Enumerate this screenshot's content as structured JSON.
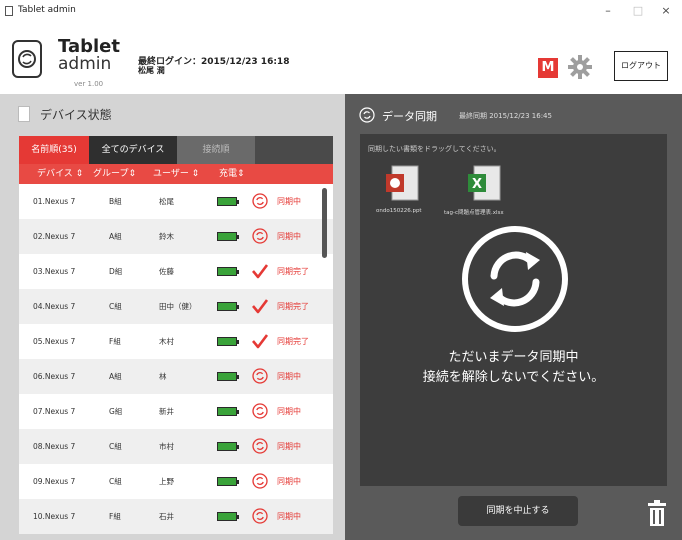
{
  "window": {
    "title": "Tablet admin",
    "minimize": "–",
    "maximize": "□",
    "close": "×"
  },
  "header": {
    "logo_line1": "Tablet",
    "logo_line2": "admin",
    "version": "ver 1.00",
    "last_login": "最終ログイン：2015/12/23 16:18",
    "user": "松尾 潤",
    "badge": "M",
    "logout": "ログアウト",
    "icons": {
      "logo": "tablet-sync-icon",
      "settings": "gear-icon"
    }
  },
  "device_panel": {
    "title": "デバイス状態",
    "tabs": [
      {
        "label": "名前順(35)"
      },
      {
        "label": "全てのデバイス"
      },
      {
        "label": "接続順"
      }
    ],
    "columns": [
      "デバイス ⇕",
      "グループ⇕",
      "ユーザー ⇕",
      "充電⇕"
    ],
    "rows": [
      {
        "device": "01.Nexus 7",
        "group": "B組",
        "user": "松尾",
        "status": "同期中",
        "state": "sync"
      },
      {
        "device": "02.Nexus 7",
        "group": "A組",
        "user": "鈴木",
        "status": "同期中",
        "state": "sync"
      },
      {
        "device": "03.Nexus 7",
        "group": "D組",
        "user": "佐藤",
        "status": "同期完了",
        "state": "done"
      },
      {
        "device": "04.Nexus 7",
        "group": "C組",
        "user": "田中（健）",
        "status": "同期完了",
        "state": "done"
      },
      {
        "device": "05.Nexus 7",
        "group": "F組",
        "user": "木村",
        "status": "同期完了",
        "state": "done"
      },
      {
        "device": "06.Nexus 7",
        "group": "A組",
        "user": "林",
        "status": "同期中",
        "state": "sync"
      },
      {
        "device": "07.Nexus 7",
        "group": "G組",
        "user": "新井",
        "status": "同期中",
        "state": "sync"
      },
      {
        "device": "08.Nexus 7",
        "group": "C組",
        "user": "市村",
        "status": "同期中",
        "state": "sync"
      },
      {
        "device": "09.Nexus 7",
        "group": "C組",
        "user": "上野",
        "status": "同期中",
        "state": "sync"
      },
      {
        "device": "10.Nexus 7",
        "group": "F組",
        "user": "石井",
        "status": "同期中",
        "state": "sync"
      }
    ]
  },
  "sync_panel": {
    "title": "データ同期",
    "last_sync": "最終同期 2015/12/23 16:45",
    "drop_hint": "同期したい書類をドラッグしてください。",
    "files": [
      {
        "name": "ondo150226.ppt",
        "icon": "powerpoint-file-icon"
      },
      {
        "name": "tag-c問題点管理表.xlsx",
        "icon": "excel-file-icon"
      }
    ],
    "message_line1": "ただいまデータ同期中",
    "message_line2": "接続を解除しないでください。",
    "stop_button": "同期を中止する",
    "colors": {
      "accent": "#e53935",
      "panel": "#5a5a5a"
    }
  }
}
